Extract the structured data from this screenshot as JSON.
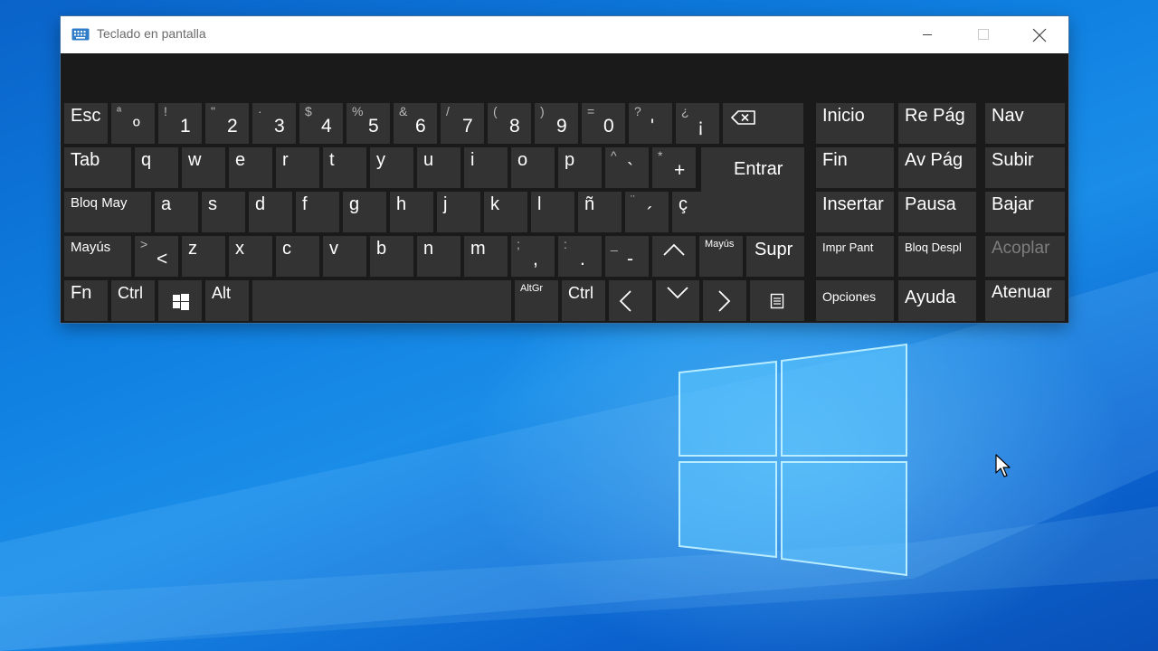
{
  "window": {
    "title": "Teclado en pantalla",
    "icon": "keyboard-icon",
    "controls": [
      "minimize-icon",
      "maximize-icon",
      "close-icon"
    ]
  },
  "keys": {
    "esc": "Esc",
    "ordinal": {
      "sec": "ª",
      "pri": "º"
    },
    "d1": {
      "sec": "!",
      "pri": "1"
    },
    "d2": {
      "sec": "\"",
      "pri": "2"
    },
    "d3": {
      "sec": "·",
      "pri": "3"
    },
    "d4": {
      "sec": "$",
      "pri": "4"
    },
    "d5": {
      "sec": "%",
      "pri": "5"
    },
    "d6": {
      "sec": "&",
      "pri": "6"
    },
    "d7": {
      "sec": "/",
      "pri": "7"
    },
    "d8": {
      "sec": "(",
      "pri": "8"
    },
    "d9": {
      "sec": ")",
      "pri": "9"
    },
    "d0": {
      "sec": "=",
      "pri": "0"
    },
    "apos": {
      "sec": "?",
      "pri": "'"
    },
    "excl": {
      "sec": "¿",
      "pri": "¡"
    },
    "backspace": "backspace-icon",
    "tab": "Tab",
    "q": "q",
    "w": "w",
    "e": "e",
    "r": "r",
    "t": "t",
    "y": "y",
    "u": "u",
    "i": "i",
    "o": "o",
    "p": "p",
    "grave": {
      "sec": "^",
      "pri": "`"
    },
    "plus": {
      "sec": "*",
      "pri": "+"
    },
    "enter": "Entrar",
    "caps": "Bloq May",
    "a": "a",
    "s": "s",
    "d": "d",
    "f": "f",
    "g": "g",
    "h": "h",
    "j": "j",
    "k": "k",
    "l": "l",
    "ntilde": "ñ",
    "acute": {
      "sec": "¨",
      "pri": "´"
    },
    "ccedil": "ç",
    "shift": "Mayús",
    "less": {
      "sec": ">",
      "pri": "<"
    },
    "z": "z",
    "x": "x",
    "c": "c",
    "v": "v",
    "b": "b",
    "n": "n",
    "m": "m",
    "comma": {
      "sec": ";",
      "pri": ","
    },
    "period": {
      "sec": ":",
      "pri": "."
    },
    "minus": {
      "sec": "_",
      "pri": "-"
    },
    "up": "chevron-up-icon",
    "shift_right": "Mayús",
    "delete": "Supr",
    "fn": "Fn",
    "ctrl": "Ctrl",
    "win": "windows-icon",
    "alt": "Alt",
    "altgr": "AltGr",
    "ctrl_right": "Ctrl",
    "left": "chevron-left-icon",
    "down": "chevron-down-icon",
    "right": "chevron-right-icon",
    "menu": "menu-icon",
    "home": "Inicio",
    "pgup": "Re Pág",
    "nav": "Nav",
    "end": "Fin",
    "pgdn": "Av Pág",
    "mvup": "Subir",
    "insert": "Insertar",
    "pause": "Pausa",
    "mvdown": "Bajar",
    "prtsc": "Impr Pant",
    "scrlk": "Bloq Despl",
    "dock": "Acoplar",
    "options": "Opciones",
    "help": "Ayuda",
    "fade": "Atenuar"
  },
  "colors": {
    "desktop_blue": "#0f7fe0",
    "key_bg": "#333333",
    "keyboard_bg": "#1a1a1a",
    "titlebar_bg": "#ffffff",
    "disabled_text": "#7e7e7e"
  }
}
